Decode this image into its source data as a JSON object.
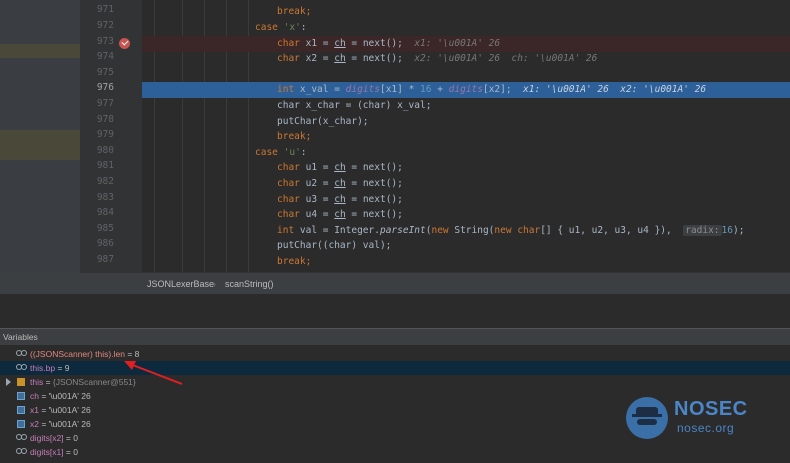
{
  "editor": {
    "line_numbers": [
      "971",
      "972",
      "973",
      "974",
      "975",
      "976",
      "977",
      "978",
      "979",
      "980",
      "981",
      "982",
      "983",
      "984",
      "985",
      "986",
      "987"
    ],
    "current_line": "976",
    "lines": {
      "l971": "break;",
      "l972": {
        "kw": "case",
        "lit": "'x'",
        "rest": ":"
      },
      "l973": {
        "type": "char",
        "a": " x1 = ",
        "ch": "ch",
        "b": " = next();",
        "inline": "x1: '\\u001A' 26"
      },
      "l974": {
        "type": "char",
        "a": " x2 = ",
        "ch": "ch",
        "b": " = next();",
        "inline": "x2: '\\u001A' 26  ch: '\\u001A' 26"
      },
      "l976": {
        "type": "int",
        "a": " x_val = ",
        "f1": "digits",
        "b": "[x1] * ",
        "n16": "16",
        "c": " + ",
        "f2": "digits",
        "d": "[x2];",
        "inline": "x1: '\\u001A' 26  x2: '\\u001A' 26"
      },
      "l977": "char x_char = (char) x_val;",
      "l978": "putChar(x_char);",
      "l979": "break;",
      "l980": {
        "kw": "case",
        "lit": "'u'",
        "rest": ":"
      },
      "l981": {
        "type": "char",
        "a": " u1 = ",
        "ch": "ch",
        "b": " = next();"
      },
      "l982": {
        "type": "char",
        "a": " u2 = ",
        "ch": "ch",
        "b": " = next();"
      },
      "l983": {
        "type": "char",
        "a": " u3 = ",
        "ch": "ch",
        "b": " = next();"
      },
      "l984": {
        "type": "char",
        "a": " u4 = ",
        "ch": "ch",
        "b": " = next();"
      },
      "l985": {
        "type": "int",
        "a": " val = Integer.",
        "m": "parseInt",
        "b": "(",
        "new1": "new",
        "c": " String(",
        "new2": "new",
        "d": " ",
        "char": "char",
        "e": "[] { u1, u2, u3, u4 }),  ",
        "hint": "radix:",
        "n": "16",
        "f": ");"
      },
      "l986": "putChar((char) val);",
      "l987": "break;"
    }
  },
  "breadcrumb": {
    "class": "JSONLexerBase",
    "separator": "›",
    "method": "scanString()"
  },
  "variables": {
    "title": "Variables",
    "items": [
      {
        "name": "((JSONScanner) this).len",
        "value": " = 8"
      },
      {
        "name": "this.bp",
        "value": " = 9"
      },
      {
        "name": "this",
        "value": " = ",
        "type": "{JSONScanner@551}"
      },
      {
        "name": "ch",
        "value": " = '\\u001A' 26"
      },
      {
        "name": "x1",
        "value": " = '\\u001A' 26"
      },
      {
        "name": "x2",
        "value": " = '\\u001A' 26"
      },
      {
        "name": "digits[x2]",
        "value": " = 0"
      },
      {
        "name": "digits[x1]",
        "value": " = 0"
      }
    ]
  },
  "watermark": {
    "name": "NOSEC",
    "domain": "nosec.org",
    "color": "#4a86c8"
  }
}
